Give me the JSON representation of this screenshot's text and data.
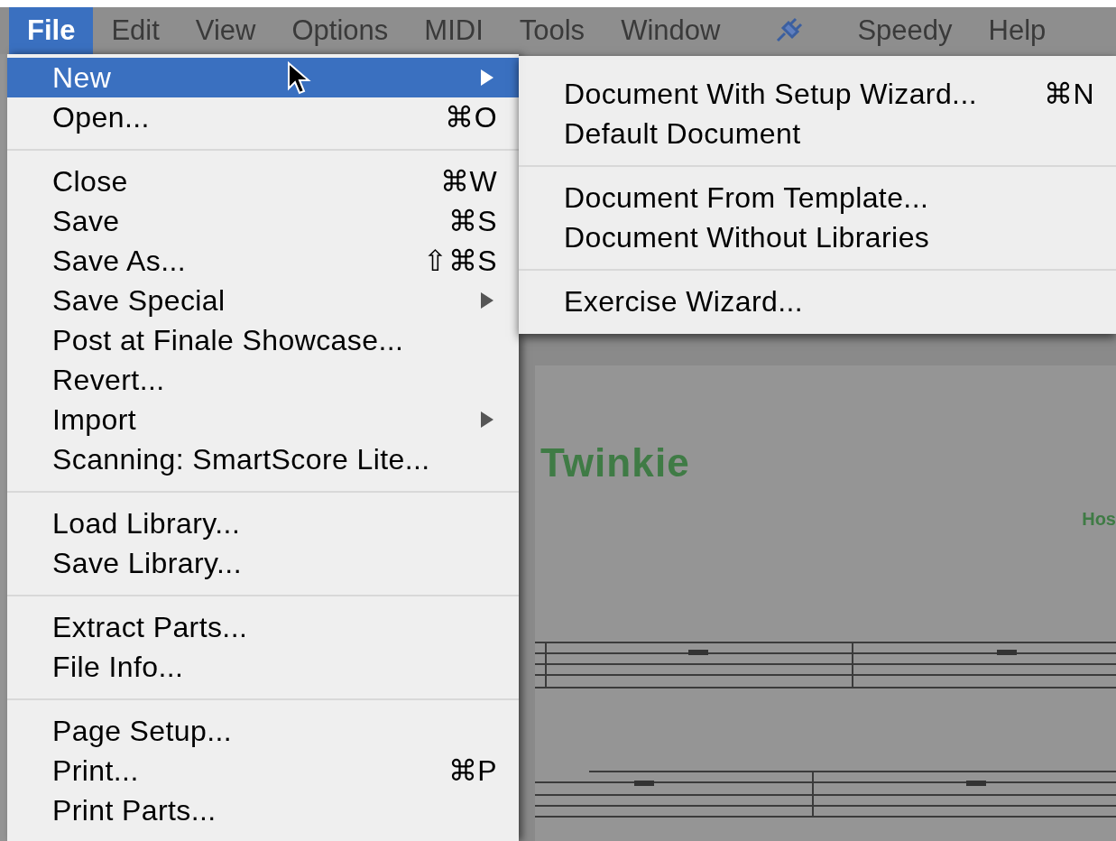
{
  "menubar": [
    {
      "kind": "text",
      "label": "File",
      "selected": true
    },
    {
      "kind": "text",
      "label": "Edit",
      "selected": false
    },
    {
      "kind": "text",
      "label": "View",
      "selected": false
    },
    {
      "kind": "text",
      "label": "Options",
      "selected": false
    },
    {
      "kind": "text",
      "label": "MIDI",
      "selected": false
    },
    {
      "kind": "text",
      "label": "Tools",
      "selected": false
    },
    {
      "kind": "text",
      "label": "Window",
      "selected": false
    },
    {
      "kind": "icon",
      "selected": false
    },
    {
      "kind": "text",
      "label": "Speedy",
      "selected": false
    },
    {
      "kind": "text",
      "label": "Help",
      "selected": false
    }
  ],
  "file_menu": [
    {
      "kind": "item",
      "label": "New",
      "has_submenu": true,
      "selected": true
    },
    {
      "kind": "item",
      "label": "Open...",
      "shortcut": "⌘O",
      "selected": false
    },
    {
      "kind": "separator"
    },
    {
      "kind": "item",
      "label": "Close",
      "shortcut": "⌘W",
      "selected": false
    },
    {
      "kind": "item",
      "label": "Save",
      "shortcut": "⌘S",
      "selected": false
    },
    {
      "kind": "item",
      "label": "Save As...",
      "shortcut": "⇧⌘S",
      "selected": false
    },
    {
      "kind": "item",
      "label": "Save Special",
      "has_submenu": true,
      "selected": false
    },
    {
      "kind": "item",
      "label": "Post at Finale Showcase...",
      "selected": false
    },
    {
      "kind": "item",
      "label": "Revert...",
      "selected": false
    },
    {
      "kind": "item",
      "label": "Import",
      "has_submenu": true,
      "selected": false
    },
    {
      "kind": "item",
      "label": "Scanning: SmartScore Lite...",
      "selected": false
    },
    {
      "kind": "separator"
    },
    {
      "kind": "item",
      "label": "Load Library...",
      "selected": false
    },
    {
      "kind": "item",
      "label": "Save Library...",
      "selected": false
    },
    {
      "kind": "separator"
    },
    {
      "kind": "item",
      "label": "Extract Parts...",
      "selected": false
    },
    {
      "kind": "item",
      "label": "File Info...",
      "selected": false
    },
    {
      "kind": "separator"
    },
    {
      "kind": "item",
      "label": "Page Setup...",
      "selected": false
    },
    {
      "kind": "item",
      "label": "Print...",
      "shortcut": "⌘P",
      "selected": false
    },
    {
      "kind": "item",
      "label": "Print Parts...",
      "selected": false
    }
  ],
  "new_submenu": [
    {
      "kind": "item",
      "label": "Document With Setup Wizard...",
      "shortcut": "⌘N"
    },
    {
      "kind": "item",
      "label": "Default Document"
    },
    {
      "kind": "separator"
    },
    {
      "kind": "item",
      "label": "Document From Template..."
    },
    {
      "kind": "item",
      "label": "Document Without Libraries"
    },
    {
      "kind": "separator"
    },
    {
      "kind": "item",
      "label": "Exercise Wizard..."
    }
  ],
  "score": {
    "title": "Twinkie",
    "composer": "Hos"
  }
}
